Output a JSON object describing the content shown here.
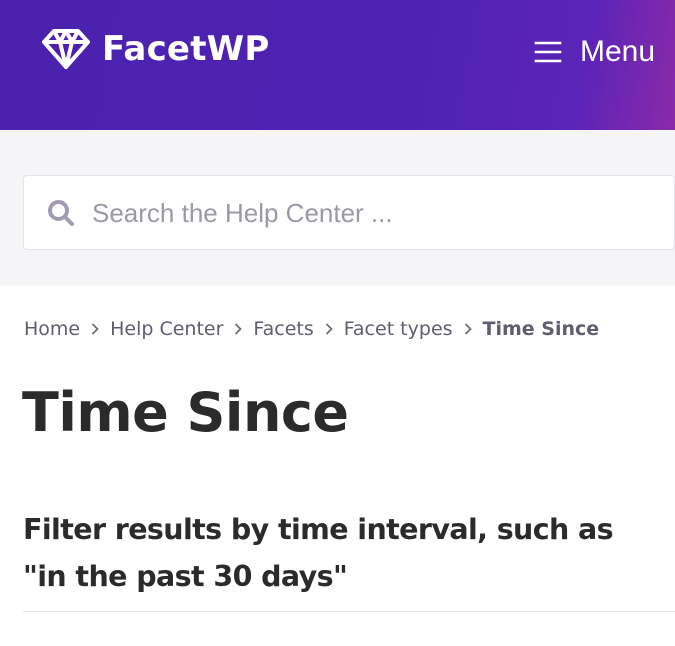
{
  "header": {
    "logo_text": "FacetWP",
    "logo_icon": "diamond-icon",
    "menu_icon": "hamburger-icon",
    "menu_label": "Menu",
    "colors": {
      "gradient_start": "#4a22ae",
      "gradient_end": "#8a2aa8"
    }
  },
  "search": {
    "icon": "search-icon",
    "placeholder": "Search the Help Center ...",
    "value": ""
  },
  "breadcrumb": {
    "items": [
      "Home",
      "Help Center",
      "Facets",
      "Facet types"
    ],
    "current": "Time Since",
    "separator_icon": "chevron-right-icon"
  },
  "article": {
    "title": "Time Since",
    "subtitle": "Filter results by time interval, such as \"in the past 30 days\""
  }
}
